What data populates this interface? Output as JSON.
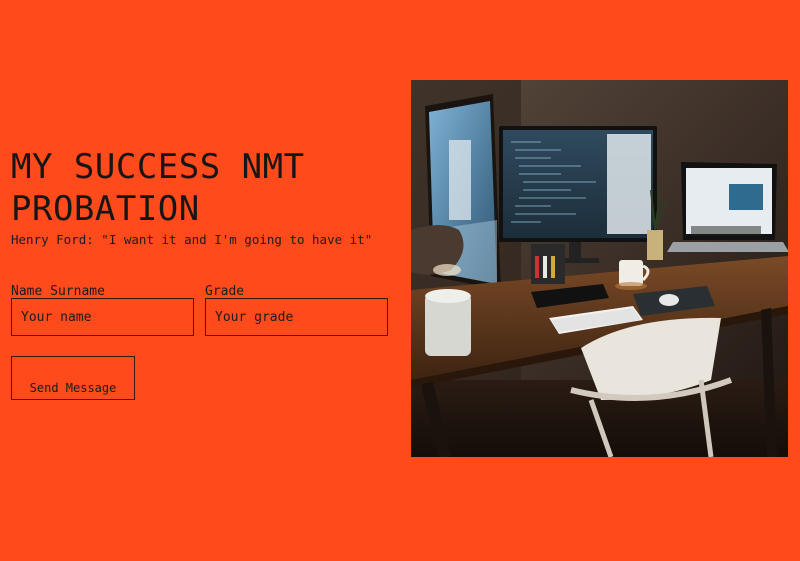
{
  "hero": {
    "title": "MY SUCCESS NMT PROBATION",
    "quote": "Henry Ford: \"I want it and I'm going to have it\""
  },
  "form": {
    "name_label": "Name Surname",
    "name_placeholder": "Your name",
    "grade_label": "Grade",
    "grade_placeholder": "Your grade",
    "submit_label": "Send Message"
  },
  "image": {
    "subject": "desk-workspace-photo"
  },
  "colors": {
    "background": "#FF4A1C",
    "text": "#1a1a1a",
    "border": "#3a1a10"
  }
}
